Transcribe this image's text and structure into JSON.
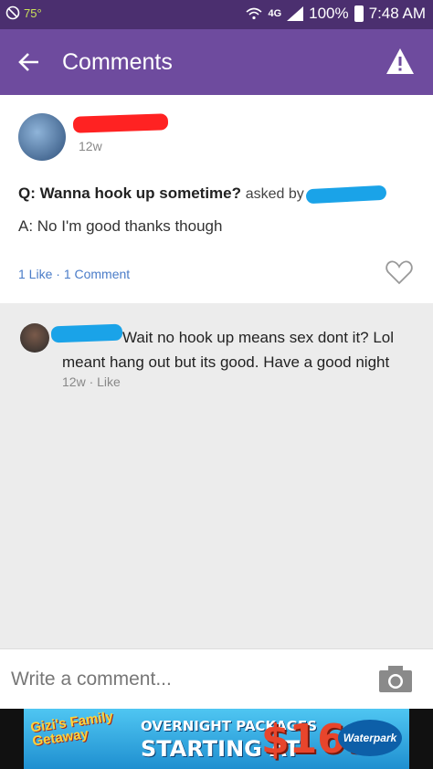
{
  "status_bar": {
    "temperature": "75°",
    "network": "4G",
    "battery": "100%",
    "time": "7:48 AM"
  },
  "app_bar": {
    "title": "Comments",
    "back_icon": "arrow-left-icon",
    "report_icon": "warning-icon"
  },
  "post": {
    "time": "12w",
    "question_prefix": "Q:",
    "question": "Wanna hook up sometime?",
    "asked_by": "asked by",
    "answer": "A: No I'm good thanks though",
    "likes": "1 Like",
    "separator": "·",
    "comments": "1 Comment"
  },
  "comment": {
    "text": "Wait no hook up means sex dont it? Lol meant hang out but its good. Have a good night",
    "time": "12w",
    "separator": "·",
    "like_label": "Like"
  },
  "composer": {
    "placeholder": "Write a comment...",
    "camera_icon": "camera-icon"
  },
  "ad": {
    "logo": "Gizi's Family Getaway",
    "line1": "OVERNIGHT PACKAGES",
    "line2": "STARTING AT",
    "price": "$169",
    "brand": "Waterpark"
  },
  "colors": {
    "status_bar": "#4b2f6f",
    "app_bar": "#6e4b9e",
    "link": "#4a7cc8"
  }
}
